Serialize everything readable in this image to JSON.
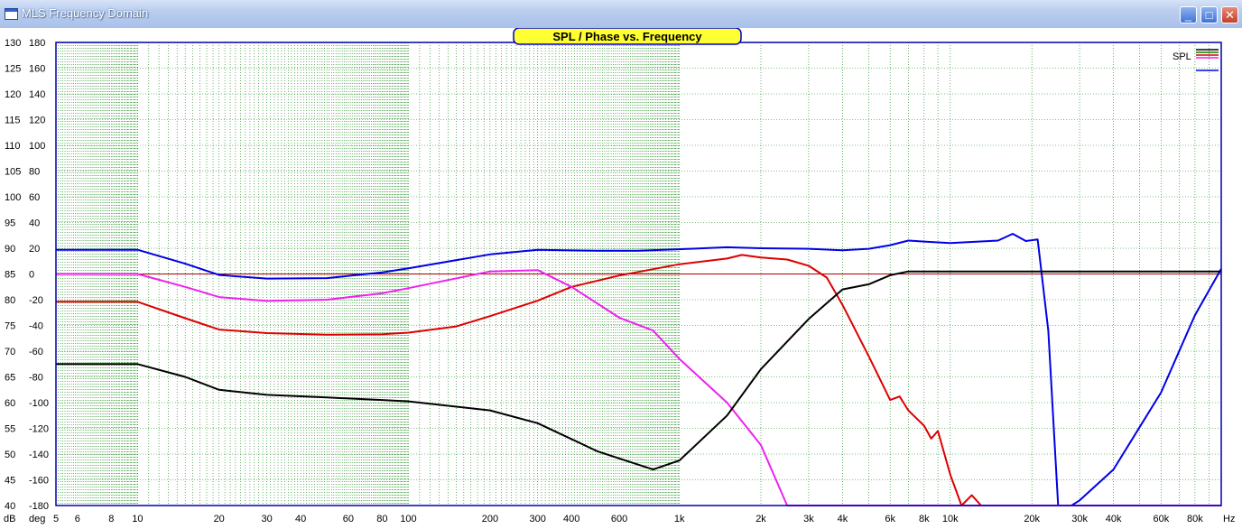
{
  "window": {
    "title": "MLS Frequency Domain",
    "minimize_glyph": "_",
    "maximize_glyph": "□",
    "close_glyph": "✕"
  },
  "colors": {
    "spl": "#0000e6",
    "trace_red": "#dd0000",
    "trace_magenta": "#ee22ee",
    "trace_black": "#000000",
    "grid": "#008000",
    "title_bg": "#ffff33",
    "zero_line": "#aa0000"
  },
  "chart_data": {
    "type": "line",
    "title": "SPL / Phase vs. Frequency",
    "x_scale": "log",
    "xlim": [
      5,
      100000
    ],
    "xlabel": "Hz",
    "x_ticks": [
      {
        "v": 5,
        "label": "5"
      },
      {
        "v": 6,
        "label": "6"
      },
      {
        "v": 8,
        "label": "8"
      },
      {
        "v": 10,
        "label": "10"
      },
      {
        "v": 20,
        "label": "20"
      },
      {
        "v": 30,
        "label": "30"
      },
      {
        "v": 40,
        "label": "40"
      },
      {
        "v": 60,
        "label": "60"
      },
      {
        "v": 80,
        "label": "80"
      },
      {
        "v": 100,
        "label": "100"
      },
      {
        "v": 200,
        "label": "200"
      },
      {
        "v": 300,
        "label": "300"
      },
      {
        "v": 400,
        "label": "400"
      },
      {
        "v": 600,
        "label": "600"
      },
      {
        "v": 1000,
        "label": "1k"
      },
      {
        "v": 2000,
        "label": "2k"
      },
      {
        "v": 3000,
        "label": "3k"
      },
      {
        "v": 4000,
        "label": "4k"
      },
      {
        "v": 6000,
        "label": "6k"
      },
      {
        "v": 8000,
        "label": "8k"
      },
      {
        "v": 10000,
        "label": "10k"
      },
      {
        "v": 20000,
        "label": "20k"
      },
      {
        "v": 30000,
        "label": "30k"
      },
      {
        "v": 40000,
        "label": "40k"
      },
      {
        "v": 60000,
        "label": "60k"
      },
      {
        "v": 80000,
        "label": "80k"
      }
    ],
    "y_left": {
      "label": "dB",
      "lim": [
        40,
        130
      ],
      "step": 5
    },
    "y_right": {
      "label": "deg",
      "lim": [
        -180,
        180
      ],
      "step": 20
    },
    "legend": {
      "label": "SPL",
      "position": "top-right"
    },
    "grid": true,
    "series": [
      {
        "color": "#0000e6",
        "axis": "dB",
        "points": [
          [
            5,
            89.7
          ],
          [
            10,
            89.7
          ],
          [
            15,
            87
          ],
          [
            20,
            84.8
          ],
          [
            30,
            84.1
          ],
          [
            50,
            84.2
          ],
          [
            80,
            85.3
          ],
          [
            100,
            86.1
          ],
          [
            200,
            88.8
          ],
          [
            300,
            89.7
          ],
          [
            500,
            89.5
          ],
          [
            700,
            89.5
          ],
          [
            1000,
            89.8
          ],
          [
            1500,
            90.2
          ],
          [
            2000,
            90.0
          ],
          [
            3000,
            89.9
          ],
          [
            4000,
            89.6
          ],
          [
            5000,
            89.9
          ],
          [
            6000,
            90.6
          ],
          [
            7000,
            91.5
          ],
          [
            8000,
            91.3
          ],
          [
            10000,
            91.0
          ],
          [
            15000,
            91.5
          ],
          [
            17000,
            92.8
          ],
          [
            19000,
            91.4
          ],
          [
            21000,
            91.7
          ],
          [
            23000,
            74
          ],
          [
            25000,
            40
          ],
          [
            28000,
            40
          ],
          [
            30000,
            41
          ],
          [
            40000,
            47
          ],
          [
            60000,
            62
          ],
          [
            80000,
            77
          ],
          [
            100000,
            86
          ]
        ]
      },
      {
        "color": "#dd0000",
        "axis": "dB",
        "points": [
          [
            5,
            79.6
          ],
          [
            10,
            79.6
          ],
          [
            15,
            76.4
          ],
          [
            20,
            74.2
          ],
          [
            30,
            73.5
          ],
          [
            50,
            73.2
          ],
          [
            80,
            73.3
          ],
          [
            100,
            73.6
          ],
          [
            150,
            74.8
          ],
          [
            200,
            76.8
          ],
          [
            300,
            79.8
          ],
          [
            400,
            82.5
          ],
          [
            600,
            84.7
          ],
          [
            1000,
            86.9
          ],
          [
            1500,
            88.0
          ],
          [
            1700,
            88.7
          ],
          [
            2000,
            88.2
          ],
          [
            2500,
            87.8
          ],
          [
            3000,
            86.6
          ],
          [
            3500,
            84.3
          ],
          [
            4000,
            79
          ],
          [
            5000,
            69
          ],
          [
            6000,
            60.5
          ],
          [
            6500,
            61.2
          ],
          [
            7000,
            58.5
          ],
          [
            8000,
            55.5
          ],
          [
            8500,
            53
          ],
          [
            9000,
            54.5
          ],
          [
            10000,
            46
          ],
          [
            11000,
            40
          ],
          [
            12000,
            42
          ],
          [
            13000,
            40
          ],
          [
            100000,
            40
          ]
        ]
      },
      {
        "color": "#ee22ee",
        "axis": "deg",
        "points": [
          [
            5,
            0
          ],
          [
            10,
            0
          ],
          [
            15,
            -10
          ],
          [
            20,
            -18
          ],
          [
            30,
            -21
          ],
          [
            50,
            -20
          ],
          [
            80,
            -15
          ],
          [
            100,
            -11
          ],
          [
            200,
            2
          ],
          [
            300,
            3
          ],
          [
            400,
            -10
          ],
          [
            600,
            -34
          ],
          [
            800,
            -44
          ],
          [
            1000,
            -66
          ],
          [
            1500,
            -100
          ],
          [
            2000,
            -133
          ],
          [
            2500,
            -180
          ],
          [
            100000,
            -180
          ]
        ]
      },
      {
        "color": "#000000",
        "axis": "deg",
        "points": [
          [
            5,
            -70
          ],
          [
            10,
            -70
          ],
          [
            15,
            -80
          ],
          [
            20,
            -90
          ],
          [
            30,
            -94
          ],
          [
            50,
            -96
          ],
          [
            80,
            -98
          ],
          [
            100,
            -99
          ],
          [
            200,
            -106
          ],
          [
            300,
            -116
          ],
          [
            500,
            -138
          ],
          [
            800,
            -152
          ],
          [
            1000,
            -145
          ],
          [
            1500,
            -110
          ],
          [
            2000,
            -74
          ],
          [
            3000,
            -35
          ],
          [
            4000,
            -12
          ],
          [
            5000,
            -8
          ],
          [
            6000,
            -1
          ],
          [
            7000,
            2
          ],
          [
            100000,
            2
          ]
        ]
      }
    ]
  }
}
